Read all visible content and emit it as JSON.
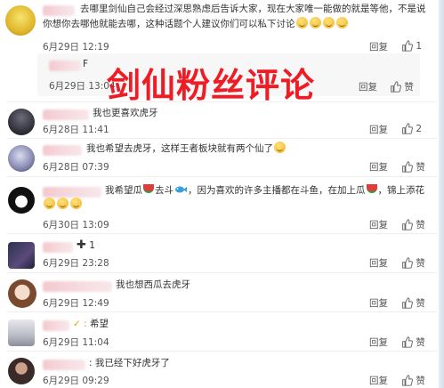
{
  "overlay_title": "剑仙粉丝评论",
  "reply_label": "回复",
  "comments": [
    {
      "text_line1": "去哪里剑仙自己会经过深思熟虑后告诉大家，现在大家唯一能做的就是等他，不是说",
      "text_line2": "你想你去哪他就能去哪，这种话题个人建议你们可以私下讨论",
      "time": "6月29日 12:19",
      "likes": "1"
    },
    {
      "text": "F",
      "time": "6月29日 13:04",
      "likes": "赞",
      "is_subreply": true
    },
    {
      "text": "我也更喜欢虎牙",
      "time": "6月28日 11:41",
      "likes": "2"
    },
    {
      "text": "我也希望去虎牙，这样王者板块就有两个仙了",
      "time": "6月28日 07:39",
      "likes": "赞"
    },
    {
      "text_a": "我希望瓜",
      "text_b": "去斗",
      "text_c": "，因为喜欢的许多主播都在斗鱼，在加上瓜",
      "text_d": "，锦上添花",
      "time": "6月30日 13:09",
      "likes": "赞"
    },
    {
      "text": "1",
      "time": "6月29日 23:28",
      "likes": "赞"
    },
    {
      "text": "我也想西瓜去虎牙",
      "time": "6月29日 12:49",
      "likes": "赞"
    },
    {
      "text": "希望",
      "time": "6月29日 11:04",
      "likes": "赞"
    },
    {
      "text": "我已经下好虎牙了",
      "time": "6月29日 09:29",
      "likes": "赞"
    }
  ],
  "colors": {
    "overlay": "#ee1c25",
    "name_blur": "#f3c9cf"
  }
}
